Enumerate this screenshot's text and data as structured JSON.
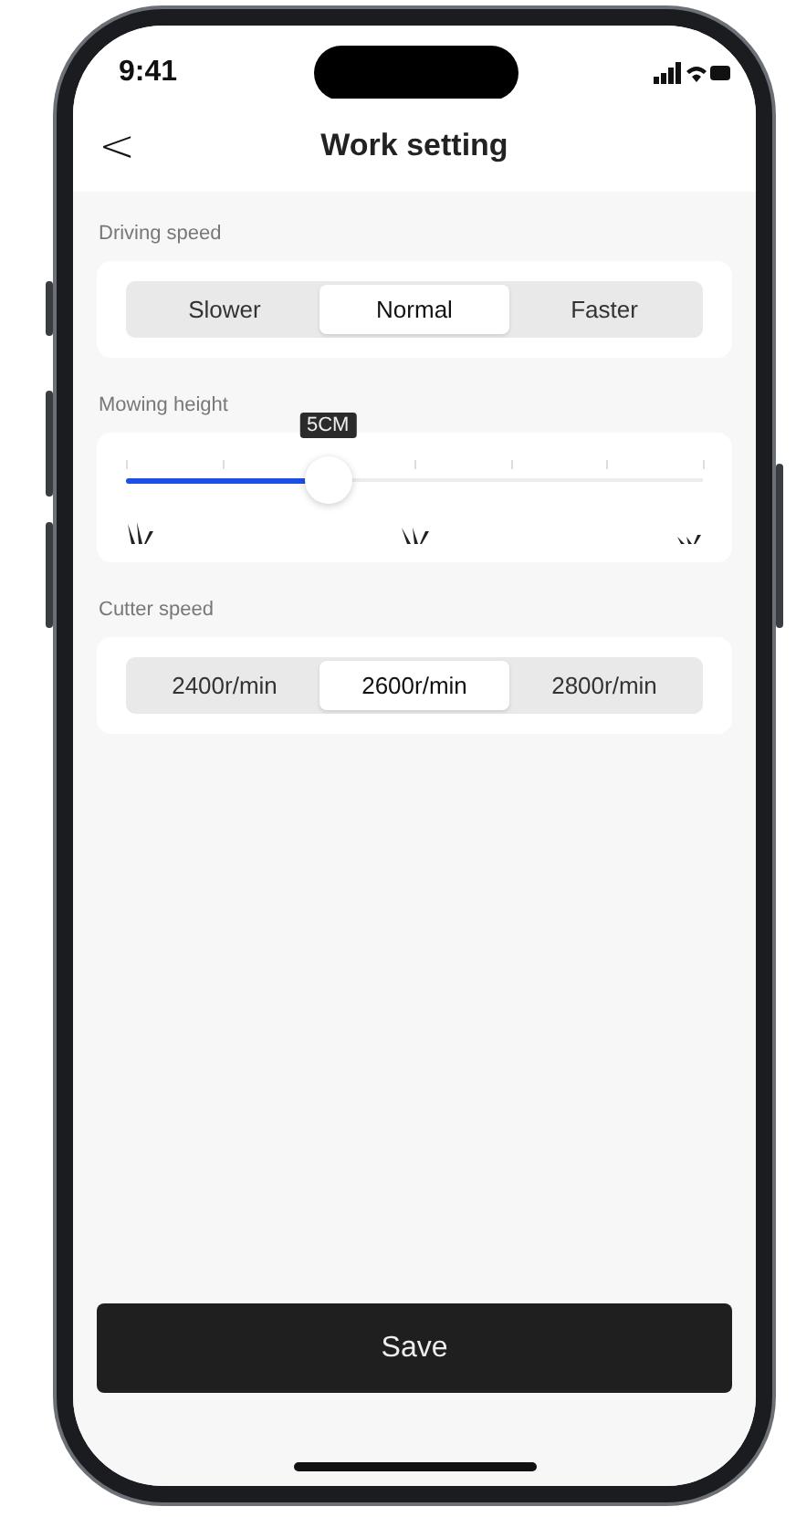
{
  "status_bar": {
    "time": "9:41"
  },
  "header": {
    "back": "<",
    "title": "Work setting"
  },
  "sections": [
    {
      "kind": "segments",
      "label": "Driving speed",
      "options": [
        {
          "label": "Slower",
          "selected": false
        },
        {
          "label": "Normal",
          "selected": true
        },
        {
          "label": "Faster",
          "selected": false
        }
      ]
    },
    {
      "kind": "slider",
      "label": "Mowing height",
      "level": 0.35,
      "value": "5CM"
    },
    {
      "kind": "segments",
      "label": "Cutter speed",
      "options": [
        {
          "label": "2400r/min",
          "selected": false
        },
        {
          "label": "2600r/min",
          "selected": true
        },
        {
          "label": "2800r/min",
          "selected": false
        }
      ]
    }
  ],
  "save_button": "Save"
}
